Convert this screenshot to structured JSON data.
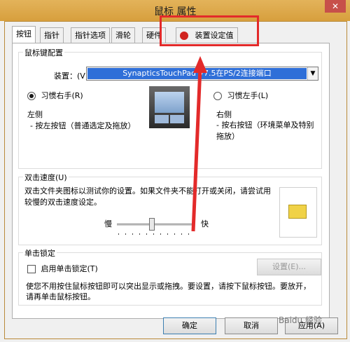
{
  "window": {
    "title": "鼠标 属性",
    "close": "✕"
  },
  "tabs": [
    "按钮",
    "指针",
    "指针选项",
    "滑轮",
    "硬件",
    "装置设定值"
  ],
  "button_config": {
    "group_label": "鼠标键配置",
    "device_label": "装置：(V)",
    "device_value": "SynapticsTouchPad V7.5在PS/2连接端口",
    "right_hand_label": "习惯右手(R)",
    "left_hand_label": "习惯左手(L)",
    "left_title": "左侧",
    "left_desc": "- 按左按钮（普通选定及拖放）",
    "right_title": "右侧",
    "right_desc": "- 按右按钮（环境菜单及特别拖放）"
  },
  "double_click": {
    "group_label": "双击速度(U)",
    "desc": "双击文件夹图标以测试你的设置。如果文件夹不能打开或关闭，请尝试用较慢的双击速度设定。",
    "slow": "慢",
    "fast": "快",
    "speed_fraction": 0.45
  },
  "click_lock": {
    "group_label": "单击锁定",
    "checkbox_label": "启用单击锁定(T)",
    "settings_button": "设置(E)...",
    "desc": "使您不用按住鼠标按钮即可以突出显示或拖拽。要设置，请按下鼠标按钮。要放开，请再单击鼠标按钮。"
  },
  "footer": {
    "ok": "确定",
    "cancel": "取消",
    "apply": "应用(A)"
  },
  "watermark": "Baidu 经验",
  "colors": {
    "annotation": "#e32a2a",
    "device_select": "#2f6fd8",
    "folder": "#f0d247"
  }
}
